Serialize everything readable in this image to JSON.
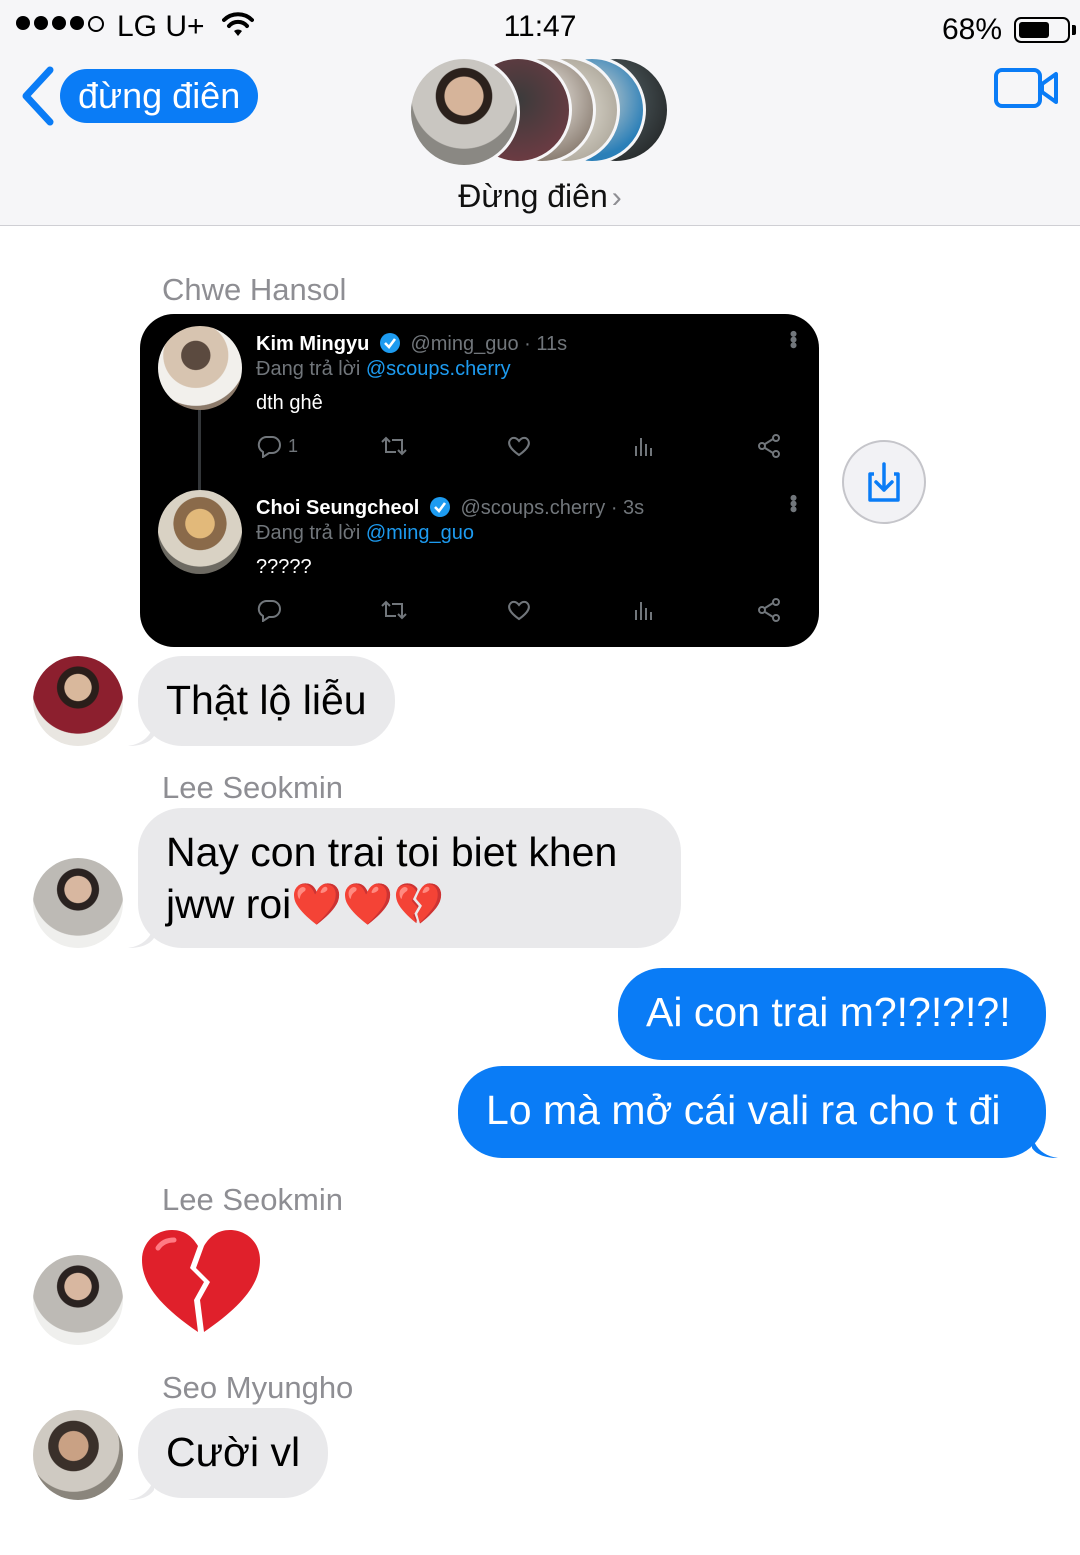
{
  "status_bar": {
    "carrier": "LG U+",
    "time": "11:47",
    "battery_percent": "68%",
    "battery_level": 0.68
  },
  "header": {
    "back_label": "đừng điên",
    "group_title": "Đừng điên",
    "chevron": "›",
    "icons": {
      "back": "chevron-left-icon",
      "video": "video-camera-icon"
    },
    "accent_color": "#0a7cf6"
  },
  "messages": [
    {
      "sender": "Chwe Hansol",
      "type": "tweet-screenshot",
      "tweets": [
        {
          "name": "Kim Mingyu",
          "handle": "@ming_guo · 11s",
          "reply_prefix": "Đang trả lời",
          "reply_to": "@scoups.cherry",
          "text": "dth ghê",
          "reply_count": "1"
        },
        {
          "name": "Choi Seungcheol",
          "handle": "@scoups.cherry · 3s",
          "reply_prefix": "Đang trả lời",
          "reply_to": "@ming_guo",
          "text": "?????",
          "reply_count": ""
        }
      ]
    },
    {
      "type": "text",
      "direction": "in",
      "text": "Thật lộ liễu"
    },
    {
      "sender": "Lee Seokmin",
      "type": "text",
      "direction": "in",
      "text_line1": "Nay con trai toi biet khen",
      "text_line2": "jww roi❤️❤️💔"
    },
    {
      "type": "text",
      "direction": "out",
      "text": "Ai con trai m?!?!?!?!"
    },
    {
      "type": "text",
      "direction": "out",
      "text": "Lo mà mở cái vali ra cho t đi"
    },
    {
      "sender": "Lee Seokmin",
      "type": "emoji",
      "emoji": "broken-heart"
    },
    {
      "sender": "Seo Myungho",
      "type": "text",
      "direction": "in",
      "text": "Cười vl"
    }
  ]
}
